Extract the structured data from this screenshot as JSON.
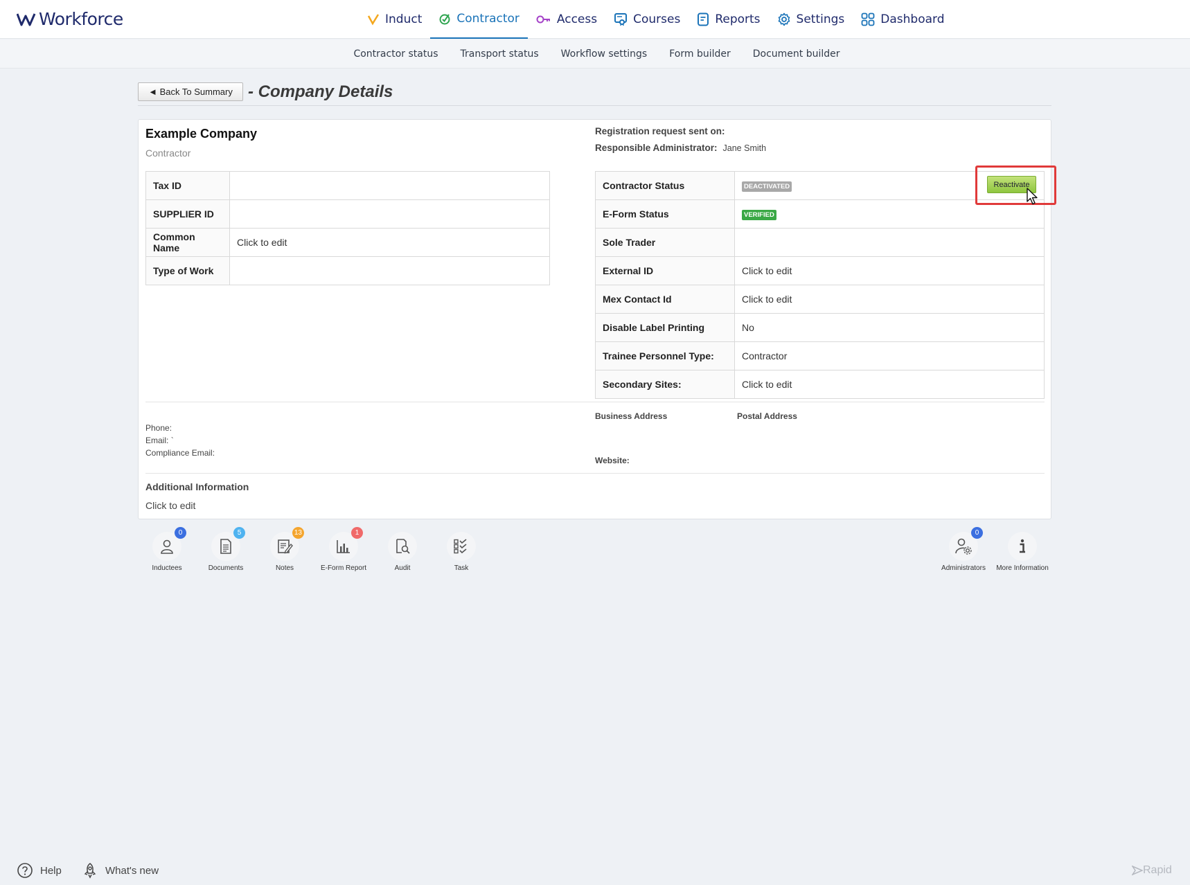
{
  "app": {
    "name": "Workforce"
  },
  "nav": [
    {
      "label": "Induct",
      "icon": "induct-check-icon",
      "color": "#f4a71d"
    },
    {
      "label": "Contractor",
      "icon": "contractor-check-icon",
      "color": "#2ea44f",
      "active": true
    },
    {
      "label": "Access",
      "icon": "key-icon",
      "color": "#a542c8"
    },
    {
      "label": "Courses",
      "icon": "courses-icon",
      "color": "#1a73b8"
    },
    {
      "label": "Reports",
      "icon": "reports-icon",
      "color": "#1a73b8"
    },
    {
      "label": "Settings",
      "icon": "gear-icon",
      "color": "#1a73b8"
    },
    {
      "label": "Dashboard",
      "icon": "grid-icon",
      "color": "#1a73b8"
    }
  ],
  "subnav": [
    "Contractor status",
    "Transport status",
    "Workflow settings",
    "Form builder",
    "Document builder"
  ],
  "header": {
    "back_label": "◄ Back To Summary",
    "title": "- Company Details"
  },
  "company": {
    "name": "Example Company",
    "type": "Contractor",
    "registration_label": "Registration request sent on:",
    "responsible_label": "Responsible Administrator:",
    "responsible_value": "Jane Smith"
  },
  "left_fields": [
    {
      "label": "Tax ID",
      "value": ""
    },
    {
      "label": "SUPPLIER ID",
      "value": ""
    },
    {
      "label": "Common Name",
      "value": "Click to edit"
    },
    {
      "label": "Type of Work",
      "value": ""
    }
  ],
  "right_fields": [
    {
      "label": "Contractor Status",
      "badge": "DEACTIVATED"
    },
    {
      "label": "E-Form Status",
      "badge": "VERIFIED"
    },
    {
      "label": "Sole Trader",
      "value": ""
    },
    {
      "label": "External ID",
      "value": "Click to edit"
    },
    {
      "label": "Mex Contact Id",
      "value": "Click to edit"
    },
    {
      "label": "Disable Label Printing",
      "value": "No"
    },
    {
      "label": "Trainee Personnel Type:",
      "value": "Contractor"
    },
    {
      "label": "Secondary Sites:",
      "value": "Click to edit"
    }
  ],
  "reactivate_label": "Reactivate",
  "contact": {
    "phone_label": "Phone:",
    "email_label": "Email:",
    "email_value": "`",
    "compliance_label": "Compliance Email:",
    "business_address_label": "Business Address",
    "postal_address_label": "Postal Address",
    "website_label": "Website:"
  },
  "additional": {
    "title": "Additional Information",
    "value": "Click to edit"
  },
  "actions": [
    {
      "label": "Inductees",
      "count": "0",
      "count_color": "#3b6fe0",
      "icon": "person-icon"
    },
    {
      "label": "Documents",
      "count": "5",
      "count_color": "#4fb3f0",
      "icon": "document-icon"
    },
    {
      "label": "Notes",
      "count": "13",
      "count_color": "#f4a52e",
      "icon": "notes-icon"
    },
    {
      "label": "E-Form Report",
      "count": "1",
      "count_color": "#f06a6a",
      "icon": "bar-chart-icon"
    },
    {
      "label": "Audit",
      "count": "",
      "icon": "audit-search-icon"
    },
    {
      "label": "Task",
      "count": "",
      "icon": "task-list-icon"
    },
    {
      "label": "Administrators",
      "count": "0",
      "count_color": "#3b6fe0",
      "icon": "admin-gear-icon"
    },
    {
      "label": "More Information",
      "count": "",
      "icon": "info-icon"
    }
  ],
  "footer": {
    "help": "Help",
    "whats_new": "What's new",
    "brand": "Rapid"
  }
}
